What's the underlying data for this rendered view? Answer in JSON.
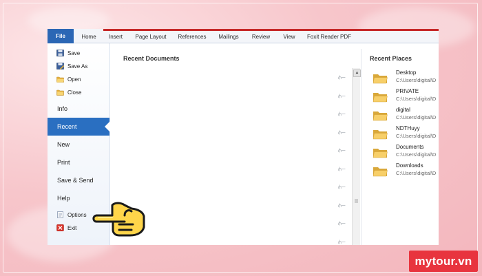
{
  "ribbon": {
    "tabs": [
      "File",
      "Home",
      "Insert",
      "Page Layout",
      "References",
      "Mailings",
      "Review",
      "View",
      "Foxit Reader PDF"
    ]
  },
  "backstage_menu": {
    "items": [
      {
        "label": "Save",
        "icon": "save-icon"
      },
      {
        "label": "Save As",
        "icon": "save-as-icon"
      },
      {
        "label": "Open",
        "icon": "open-folder-icon"
      },
      {
        "label": "Close",
        "icon": "close-folder-icon"
      },
      {
        "label": "Info"
      },
      {
        "label": "Recent",
        "selected": true
      },
      {
        "label": "New"
      },
      {
        "label": "Print"
      },
      {
        "label": "Save & Send"
      },
      {
        "label": "Help"
      },
      {
        "label": "Options",
        "icon": "options-icon"
      },
      {
        "label": "Exit",
        "icon": "exit-icon"
      }
    ]
  },
  "recent_documents": {
    "title": "Recent Documents"
  },
  "recent_places": {
    "title": "Recent Places",
    "items": [
      {
        "name": "Desktop",
        "path": "C:\\Users\\digital\\D"
      },
      {
        "name": "PRIVATE",
        "path": "C:\\Users\\digital\\D"
      },
      {
        "name": "digital",
        "path": "C:\\Users\\digital\\D"
      },
      {
        "name": "NDTHuyy",
        "path": "C:\\Users\\digital\\D"
      },
      {
        "name": "Documents",
        "path": "C:\\Users\\digital\\D"
      },
      {
        "name": "Downloads",
        "path": "C:\\Users\\digital\\D"
      }
    ]
  },
  "watermark": {
    "text": "mytour.vn"
  },
  "colors": {
    "file_tab": "#2b67b5",
    "selected_item": "#2a6fc1",
    "ribbon_accent": "#c62828",
    "folder": "#f2c35d",
    "hand": "#ffd54a",
    "brand_bg": "#e8343e"
  }
}
